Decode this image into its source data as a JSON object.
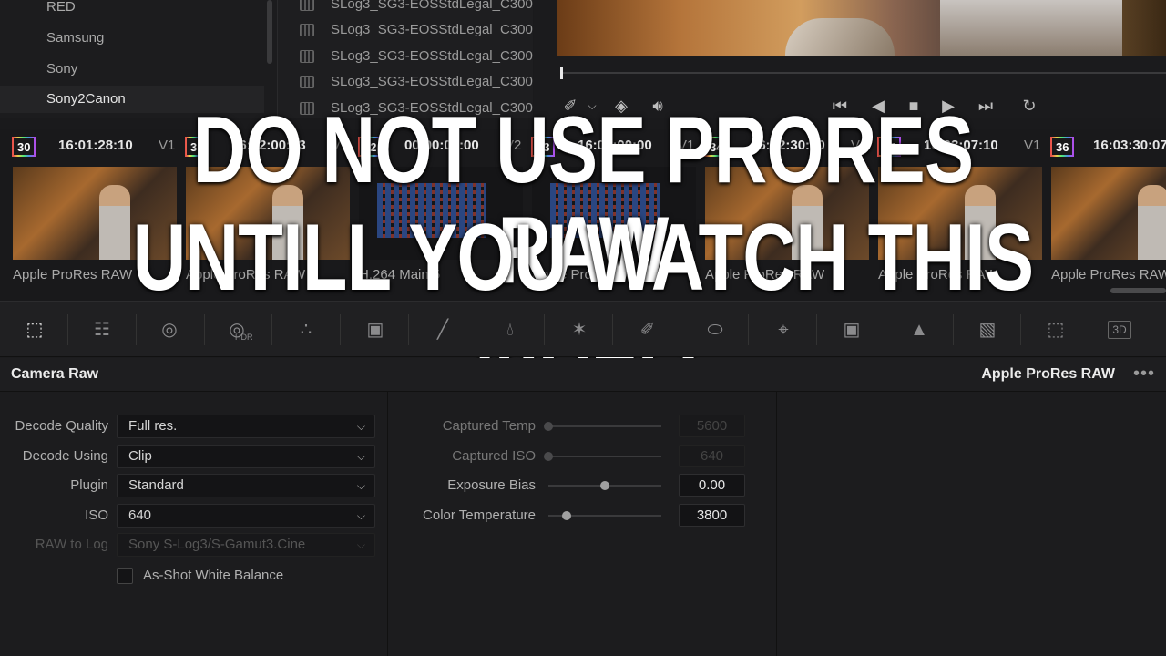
{
  "lut_folders": [
    "RED",
    "Samsung",
    "Sony",
    "Sony2Canon"
  ],
  "selected_folder": "Sony2Canon",
  "lut_items": [
    "SLog3_SG3-EOSStdLegal_C300",
    "SLog3_SG3-EOSStdLegal_C300",
    "SLog3_SG3-EOSStdLegal_C300",
    "SLog3_SG3-EOSStdLegal_C300",
    "SLog3_SG3-EOSStdLegal_C300"
  ],
  "viewer": {
    "playhead_fraction": 0.0,
    "icons": [
      "eyedropper-icon",
      "layers-icon",
      "speaker-icon",
      "skip-back-icon",
      "step-back-icon",
      "stop-icon",
      "play-icon",
      "skip-forward-icon",
      "loop-icon"
    ]
  },
  "clips": [
    {
      "num": "30",
      "tc": "16:01:28:10",
      "track": "V1",
      "label": "Apple ProRes RAW"
    },
    {
      "num": "3",
      "tc": "16:02:00:13",
      "track": "V1",
      "label": "Apple ProRes RAW"
    },
    {
      "num": "32",
      "tc": "00:00:00:00",
      "track": "V2",
      "label": "H.264 Main 5"
    },
    {
      "num": "33",
      "tc": "16:02:00:00",
      "track": "V1",
      "label": "Apple ProRes RAW"
    },
    {
      "num": "34",
      "tc": "16:02:30:20",
      "track": "V1",
      "label": "Apple ProRes RAW"
    },
    {
      "num": "35",
      "tc": "16:03:07:10",
      "track": "V1",
      "label": "Apple ProRes RAW"
    },
    {
      "num": "36",
      "tc": "16:03:30:07",
      "track": "V1",
      "label": "Apple ProRes RAW"
    }
  ],
  "overlay": {
    "line1": "DO NOT USE PRORES RAW",
    "line2": "UNTILL YOU WATCH THIS VIDEO"
  },
  "palette_icons": [
    "camera-raw-icon",
    "color-match-icon",
    "color-wheels-icon",
    "hdr-wheels-icon",
    "rgb-mixer-icon",
    "motion-effects-icon",
    "curves-icon",
    "color-warper-icon",
    "warper-mesh-icon",
    "qualifier-icon",
    "window-icon",
    "tracker-icon",
    "magic-mask-icon",
    "blur-icon",
    "key-icon",
    "sizing-icon",
    "3d-icon"
  ],
  "palette_hdr_text": "HDR",
  "palette_3d_text": "3D",
  "panel": {
    "title": "Camera Raw",
    "codec": "Apple ProRes RAW",
    "more": "•••"
  },
  "decode": [
    {
      "label": "Decode Quality",
      "value": "Full res.",
      "disabled": false
    },
    {
      "label": "Decode Using",
      "value": "Clip",
      "disabled": false
    },
    {
      "label": "Plugin",
      "value": "Standard",
      "disabled": false
    },
    {
      "label": "ISO",
      "value": "640",
      "disabled": false
    },
    {
      "label": "RAW to Log",
      "value": "Sony S-Log3/S-Gamut3.Cine",
      "disabled": true
    }
  ],
  "white_balance_label": "As-Shot White Balance",
  "white_balance_checked": false,
  "sliders": [
    {
      "label": "Captured Temp",
      "value": "5600",
      "fraction": 0.0,
      "disabled": true
    },
    {
      "label": "Captured ISO",
      "value": "640",
      "fraction": 0.0,
      "disabled": true
    },
    {
      "label": "Exposure Bias",
      "value": "0.00",
      "fraction": 0.5,
      "disabled": false
    },
    {
      "label": "Color Temperature",
      "value": "3800",
      "fraction": 0.16,
      "disabled": false
    }
  ]
}
